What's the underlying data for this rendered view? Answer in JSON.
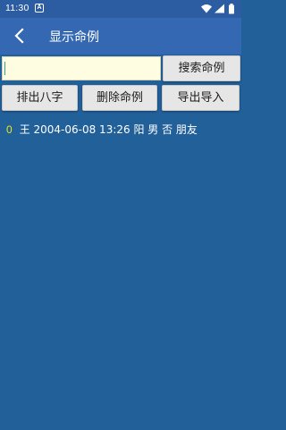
{
  "status_bar": {
    "time": "11:30",
    "notification_glyph": "A",
    "icons": [
      "wifi-icon",
      "signal-icon",
      "battery-icon"
    ]
  },
  "app_bar": {
    "title": "显示命例",
    "back_icon": "back-arrow-icon"
  },
  "search": {
    "value": "",
    "placeholder": "",
    "button_label": "搜索命例"
  },
  "actions": {
    "bazi_label": "排出八字",
    "delete_label": "删除命例",
    "export_label": "导出导入"
  },
  "records": [
    {
      "index": "0",
      "text": "王 2004-06-08 13:26 阳 男 否 朋友"
    }
  ],
  "colors": {
    "background": "#22609a",
    "app_bar": "#3468b2",
    "status_bar": "#2c5ca2",
    "input_background": "#fefde2",
    "button_background": "#e6e6e6",
    "index_color": "#e8e81c",
    "record_text": "#ffffff"
  }
}
